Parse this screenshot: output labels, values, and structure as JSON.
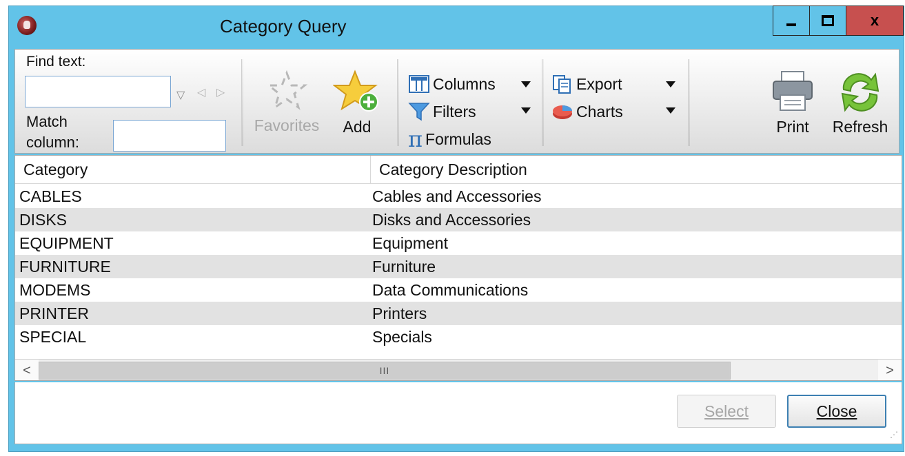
{
  "window": {
    "title": "Category Query"
  },
  "titlebar_buttons": {
    "minimize": "minimize",
    "maximize": "maximize",
    "close": "x"
  },
  "ribbon": {
    "find_text_label": "Find text:",
    "find_text_value": "",
    "match_column_label_1": "Match",
    "match_column_label_2": "column:",
    "match_column_value": "",
    "favorites_label": "Favorites",
    "add_label": "Add",
    "columns_label": "Columns",
    "filters_label": "Filters",
    "formulas_label": "Formulas",
    "export_label": "Export",
    "charts_label": "Charts",
    "print_label": "Print",
    "refresh_label": "Refresh"
  },
  "table": {
    "columns": [
      "Category",
      "Category Description"
    ],
    "rows": [
      [
        "CABLES",
        "Cables and Accessories"
      ],
      [
        "DISKS",
        "Disks and Accessories"
      ],
      [
        "EQUIPMENT",
        "Equipment"
      ],
      [
        "FURNITURE",
        "Furniture"
      ],
      [
        "MODEMS",
        "Data Communications"
      ],
      [
        "PRINTER",
        "Printers"
      ],
      [
        "SPECIAL",
        "Specials"
      ]
    ],
    "scroll_thumb_text": "III"
  },
  "footer": {
    "select_label": "Select",
    "close_label": "Close"
  },
  "colors": {
    "title_bar": "#62c3e8",
    "close_button": "#c7504f",
    "alt_row": "#e2e2e2"
  }
}
